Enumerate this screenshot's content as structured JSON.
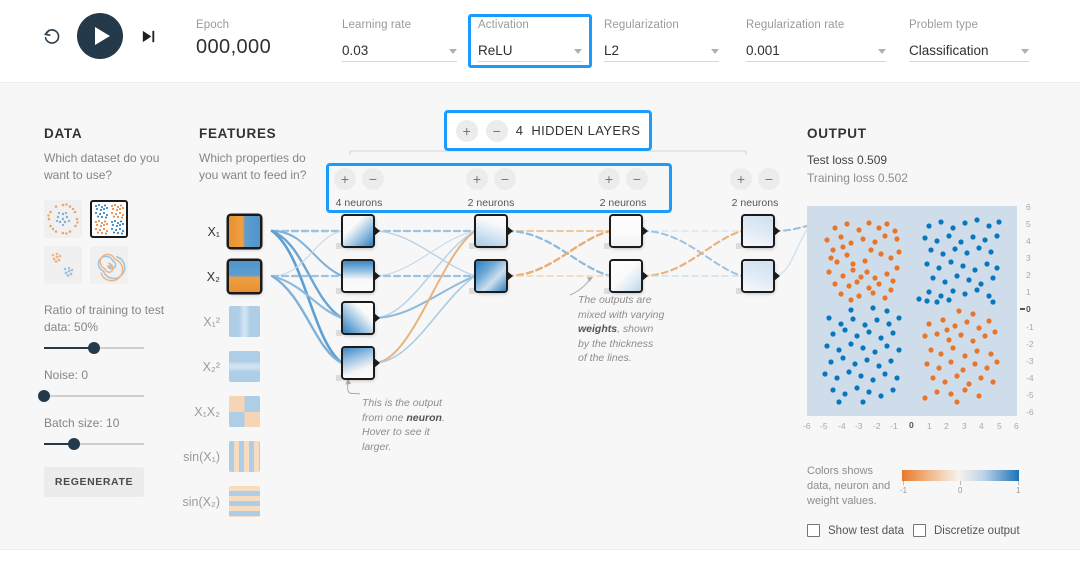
{
  "header": {
    "reset_icon": "reset-icon",
    "play_icon": "play-icon",
    "step_icon": "step-forward-icon",
    "epoch_label": "Epoch",
    "epoch_value": "000,000",
    "fields": [
      {
        "label": "Learning rate",
        "value": "0.03",
        "highlighted": false
      },
      {
        "label": "Activation",
        "value": "ReLU",
        "highlighted": true
      },
      {
        "label": "Regularization",
        "value": "L2",
        "highlighted": false
      },
      {
        "label": "Regularization rate",
        "value": "0.001",
        "highlighted": false
      },
      {
        "label": "Problem type",
        "value": "Classification",
        "highlighted": false
      }
    ]
  },
  "data_panel": {
    "title": "DATA",
    "subtitle": "Which dataset do you want to use?",
    "datasets": [
      {
        "name": "circle",
        "selected": false
      },
      {
        "name": "xor",
        "selected": true
      },
      {
        "name": "gaussian",
        "selected": false
      },
      {
        "name": "spiral",
        "selected": false
      }
    ],
    "sliders": [
      {
        "name": "ratio",
        "label": "Ratio of training to test data:  50%",
        "value": "50",
        "pct": 50
      },
      {
        "name": "noise",
        "label": "Noise:  0",
        "value": "0",
        "pct": 0
      },
      {
        "name": "batch-size",
        "label": "Batch size:  10",
        "value": "10",
        "pct": 30
      }
    ],
    "regenerate_label": "REGENERATE"
  },
  "features_panel": {
    "title": "FEATURES",
    "subtitle": "Which properties do you want to feed in?",
    "items": [
      {
        "id": "x1",
        "label": "X₁",
        "active": true
      },
      {
        "id": "x2",
        "label": "X₂",
        "active": true
      },
      {
        "id": "x1sq",
        "label": "X₁²",
        "active": false
      },
      {
        "id": "x2sq",
        "label": "X₂²",
        "active": false
      },
      {
        "id": "x1x2",
        "label": "X₁X₂",
        "active": false
      },
      {
        "id": "sinx1",
        "label": "sin(X₁)",
        "active": false
      },
      {
        "id": "sinx2",
        "label": "sin(X₂)",
        "active": false
      }
    ]
  },
  "network": {
    "hidden_layers_count": "4",
    "hidden_layers_label": "HIDDEN LAYERS",
    "plus_label": "+",
    "minus_label": "−",
    "layers": [
      {
        "index": 1,
        "neurons": 4,
        "neurons_label": "4 neurons",
        "highlighted": true
      },
      {
        "index": 2,
        "neurons": 2,
        "neurons_label": "2 neurons",
        "highlighted": true
      },
      {
        "index": 3,
        "neurons": 2,
        "neurons_label": "2 neurons",
        "highlighted": true
      },
      {
        "index": 4,
        "neurons": 2,
        "neurons_label": "2 neurons",
        "highlighted": false
      }
    ],
    "annotation_neuron": "This is the output from one neuron. Hover to see it larger.",
    "annotation_weights": "The outputs are mixed with varying weights, shown by the thickness of the lines."
  },
  "output_panel": {
    "title": "OUTPUT",
    "test_loss": "Test loss 0.509",
    "training_loss": "Training loss 0.502",
    "legend_text": "Colors shows data, neuron and weight values.",
    "gradient_min": "-1",
    "gradient_mid": "0",
    "gradient_max": "1",
    "checkboxes": [
      {
        "name": "show-test-data",
        "label": "Show test data",
        "checked": false
      },
      {
        "name": "discretize-output",
        "label": "Discretize output",
        "checked": false
      }
    ]
  },
  "colors": {
    "accent_highlight": "#1b9cfc",
    "positive": "#0877bd",
    "negative": "#e8762a",
    "dark": "#24394a",
    "plot_bg": "#cfdcea"
  },
  "chart_data": {
    "type": "scatter",
    "title": "Output decision surface with XOR dataset",
    "xlabel": "",
    "ylabel": "",
    "xlim": [
      -6,
      6
    ],
    "ylim": [
      -6,
      6
    ],
    "grid": false,
    "xticks": [
      "-6",
      "-5",
      "-4",
      "-3",
      "-2",
      "-1",
      "0",
      "1",
      "2",
      "3",
      "4",
      "5",
      "6"
    ],
    "yticks": [
      "6",
      "5",
      "4",
      "3",
      "2",
      "1",
      "0",
      "-1",
      "-2",
      "-3",
      "-4",
      "-5",
      "-6"
    ],
    "series": [
      {
        "name": "class-positive",
        "color": "#0877bd",
        "quadrants": [
          "top-right",
          "bottom-left"
        ],
        "count": 110
      },
      {
        "name": "class-negative",
        "color": "#e8762a",
        "quadrants": [
          "top-left",
          "bottom-right"
        ],
        "count": 110
      }
    ]
  }
}
